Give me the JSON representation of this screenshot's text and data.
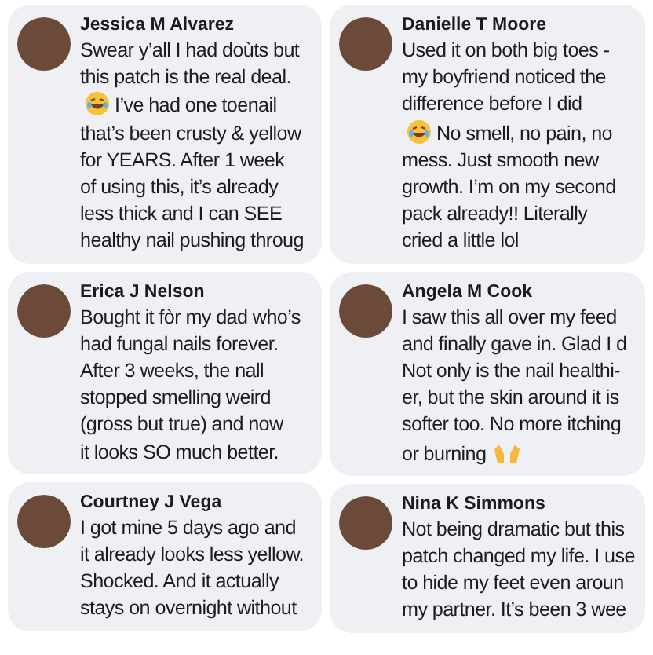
{
  "columns": [
    {
      "comments": [
        {
          "name": "Jessica M Alvarez",
          "lines": [
            {
              "kind": "text",
              "text": "Swear y’all I had doùts but"
            },
            {
              "kind": "text",
              "text": "this patch is the real deal."
            },
            {
              "kind": "emoji_lead",
              "text": "I’ve had one toenail"
            },
            {
              "kind": "text",
              "text": "that’s been crusty & yellow"
            },
            {
              "kind": "text",
              "text": "for YEARS. After 1 week"
            },
            {
              "kind": "text",
              "text": "of using this, it’s already"
            },
            {
              "kind": "text",
              "text": "less thick and I can SEE"
            },
            {
              "kind": "text",
              "text": "healthy nail pushing throug"
            }
          ]
        },
        {
          "name": "Erica J Nelson",
          "lines": [
            {
              "kind": "text",
              "text": "Bought it fòr my dad who’s"
            },
            {
              "kind": "text",
              "text": "had fungal nails forever."
            },
            {
              "kind": "text",
              "text": "After 3 weeks, the nall"
            },
            {
              "kind": "text",
              "text": "stopped smelling weird"
            },
            {
              "kind": "text",
              "text": "(gross but true) and now"
            },
            {
              "kind": "text",
              "text": "it looks SO much better."
            }
          ]
        },
        {
          "name": "Courtney J Vega",
          "lines": [
            {
              "kind": "text",
              "text": "I got mine 5 days ago and"
            },
            {
              "kind": "text",
              "text": "it already looks less yellow."
            },
            {
              "kind": "text",
              "text": "Shocked. And it actually"
            },
            {
              "kind": "text",
              "text": "stays on overnight without"
            }
          ]
        }
      ]
    },
    {
      "comments": [
        {
          "name": "Danielle T Moore",
          "lines": [
            {
              "kind": "text",
              "text": "Used it on both big toes -"
            },
            {
              "kind": "text",
              "text": "my boyfriend noticed the"
            },
            {
              "kind": "text",
              "text": "difference before I did"
            },
            {
              "kind": "emoji_lead",
              "text": "No smell, no pain, no"
            },
            {
              "kind": "text",
              "text": "mess. Just smooth new"
            },
            {
              "kind": "text",
              "text": "growth. I’m on my second"
            },
            {
              "kind": "text",
              "text": "pack already!! Literally"
            },
            {
              "kind": "text",
              "text": "cried a little lol"
            }
          ]
        },
        {
          "name": "Angela M Cook",
          "lines": [
            {
              "kind": "text",
              "text": "I saw this all over my feed"
            },
            {
              "kind": "text",
              "text": "and finally gave in. Glad I d"
            },
            {
              "kind": "text",
              "text": "Not only is the nail healthi-"
            },
            {
              "kind": "text",
              "text": "er, but the skin around it is"
            },
            {
              "kind": "text",
              "text": "softer too. No more itching"
            },
            {
              "kind": "emoji_trail",
              "text": "or burning"
            }
          ]
        },
        {
          "name": "Nina K Simmons",
          "lines": [
            {
              "kind": "text",
              "text": "Not being dramatic but this"
            },
            {
              "kind": "text",
              "text": "patch changed my life. I use"
            },
            {
              "kind": "text",
              "text": "to hide my feet even aroun"
            },
            {
              "kind": "text",
              "text": "my partner. It’s been 3 wee"
            }
          ]
        }
      ]
    }
  ]
}
